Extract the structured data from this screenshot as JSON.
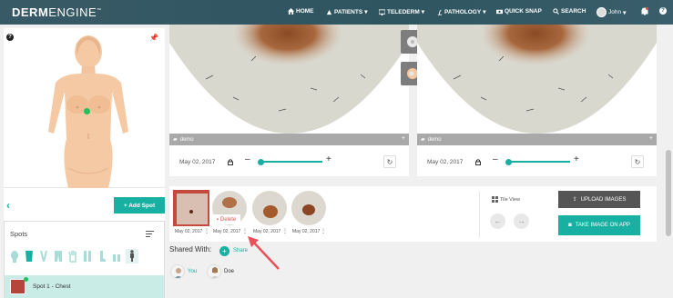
{
  "nav": {
    "logo_bold": "DERM",
    "logo_light": "ENGINE",
    "logo_tm": "™",
    "items": [
      "HOME",
      "PATIENTS",
      "TELEDERM",
      "PATHOLOGY",
      "QUICK SNAP",
      "SEARCH"
    ],
    "user": "John"
  },
  "left": {
    "help": "?",
    "add_spot": "+ Add Spot",
    "spots_title": "Spots",
    "spot_item": "Spot 1 - Chest"
  },
  "viewer": {
    "left": {
      "tag": "demo",
      "date": "May 02, 2017"
    },
    "right": {
      "tag": "demo",
      "date": "May 02, 2017"
    }
  },
  "thumbnails": {
    "dates": [
      "May 02, 2017",
      "May 02, 2017",
      "May 02, 2017",
      "May 02, 2017"
    ],
    "delete": "Delete",
    "tile_view": "Tile View",
    "upload": "UPLOAD IMAGES",
    "take": "TAKE IMAGE ON APP"
  },
  "shared": {
    "label": "Shared With:",
    "share": "Share",
    "users": [
      "You",
      "Doe"
    ]
  },
  "colors": {
    "accent": "#17b0a2",
    "nav": "#2e5560"
  }
}
